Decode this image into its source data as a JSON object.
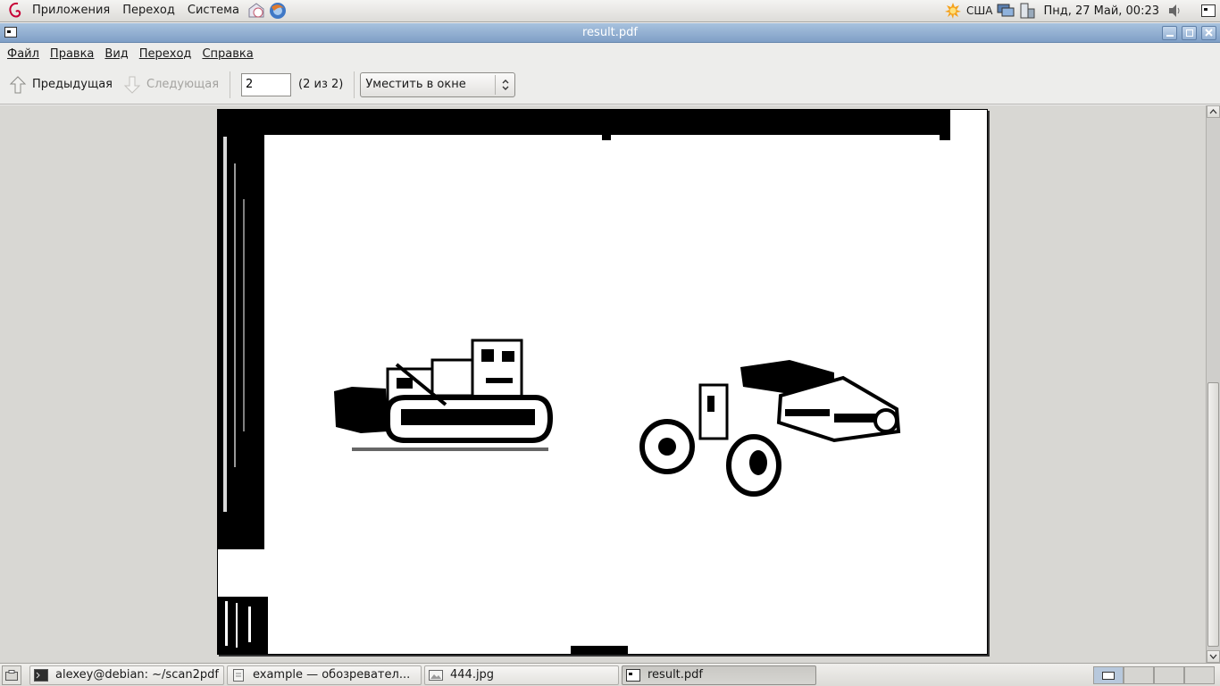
{
  "top_panel": {
    "menus": [
      "Приложения",
      "Переход",
      "Система"
    ],
    "keyboard_layout": "США",
    "clock": "Пнд, 27 Май, 00:23"
  },
  "window": {
    "title": "result.pdf"
  },
  "menubar": {
    "items": [
      {
        "label": "Файл"
      },
      {
        "label": "Правка"
      },
      {
        "label": "Вид"
      },
      {
        "label": "Переход"
      },
      {
        "label": "Справка"
      }
    ]
  },
  "toolbar": {
    "prev_label": "Предыдущая",
    "next_label": "Следующая",
    "page_value": "2",
    "page_count": "(2 из 2)",
    "zoom_value": "Уместить в окне"
  },
  "taskbar": {
    "tasks": [
      {
        "label": "alexey@debian: ~/scan2pdf",
        "icon": "terminal-icon"
      },
      {
        "label": "example — обозревател...",
        "icon": "file-browser-icon"
      },
      {
        "label": "444.jpg",
        "icon": "image-icon"
      },
      {
        "label": "result.pdf",
        "icon": "document-viewer-icon"
      }
    ]
  },
  "colors": {
    "titlebar": "#8aa8cc",
    "panel": "#e6e5e1",
    "doc_background": "#d8d7d3"
  }
}
